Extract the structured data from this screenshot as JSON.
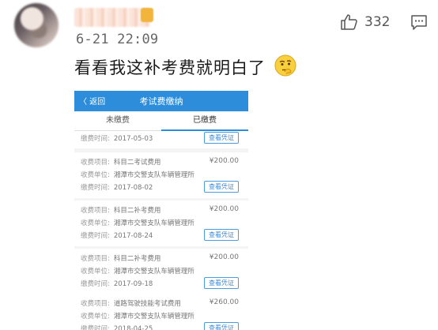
{
  "comment": {
    "timestamp": "6-21 22:09",
    "like_count": "332",
    "text": "看看我这补考费就明白了"
  },
  "screenshot": {
    "nav": {
      "back_label": "〈 返回",
      "title": "考试费缴纳"
    },
    "tabs": [
      {
        "label": "未缴费",
        "active": false
      },
      {
        "label": "已缴费",
        "active": true
      }
    ],
    "button_label": "查看凭证",
    "field_labels": {
      "item": "收费项目:",
      "unit": "收费单位:",
      "time": "缴费时间:"
    },
    "records": [
      {
        "date": "2017-05-03"
      },
      {
        "item": "科目二考试费用",
        "amount": "¥200.00",
        "unit": "湘潭市交警支队车辆管理所",
        "date": "2017-08-02"
      },
      {
        "item": "科目二补考费用",
        "amount": "¥200.00",
        "unit": "湘潭市交警支队车辆管理所",
        "date": "2017-08-24"
      },
      {
        "item": "科目二补考费用",
        "amount": "¥200.00",
        "unit": "湘潭市交警支队车辆管理所",
        "date": "2017-09-18"
      },
      {
        "item": "道路驾驶技能考试费用",
        "amount": "¥260.00",
        "unit": "湘潭市交警支队车辆管理所",
        "date": "2018-04-25"
      }
    ]
  }
}
